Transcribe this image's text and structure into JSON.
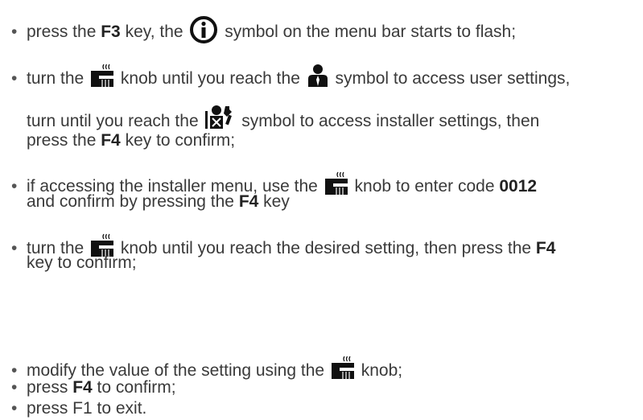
{
  "instructions": {
    "l1": {
      "a": "press the ",
      "key": "F3",
      "b": " key, the ",
      "c": " symbol on the menu bar starts to flash;"
    },
    "l2": {
      "a": "turn the ",
      "b": " knob until you reach the ",
      "c": " symbol to access user settings,"
    },
    "l3": {
      "a": "turn until you reach the ",
      "b": " symbol to access installer settings, then"
    },
    "l4": {
      "a": "press the ",
      "key": "F4",
      "b": " key to confirm;"
    },
    "l5": {
      "a": "if accessing the installer menu, use the ",
      "b": " knob to enter code ",
      "code": "0012"
    },
    "l6": {
      "a": "and confirm by pressing the ",
      "key": "F4",
      "b": " key"
    },
    "l7": {
      "a": "turn the ",
      "b": " knob until you reach the desired setting, then press the ",
      "key": "F4"
    },
    "l8": {
      "a": "key to confirm;"
    },
    "l9": {
      "a": "modify the value of the setting using the ",
      "b": " knob;"
    },
    "l10": {
      "a": "press ",
      "key": "F4",
      "b": " to confirm;"
    },
    "l11": {
      "a": "press F1 to exit."
    }
  },
  "bullet_char": "•",
  "icons": {
    "info": "info-circle-icon",
    "knob": "boiler-knob-icon",
    "user": "user-icon",
    "installer": "installer-tools-icon"
  }
}
